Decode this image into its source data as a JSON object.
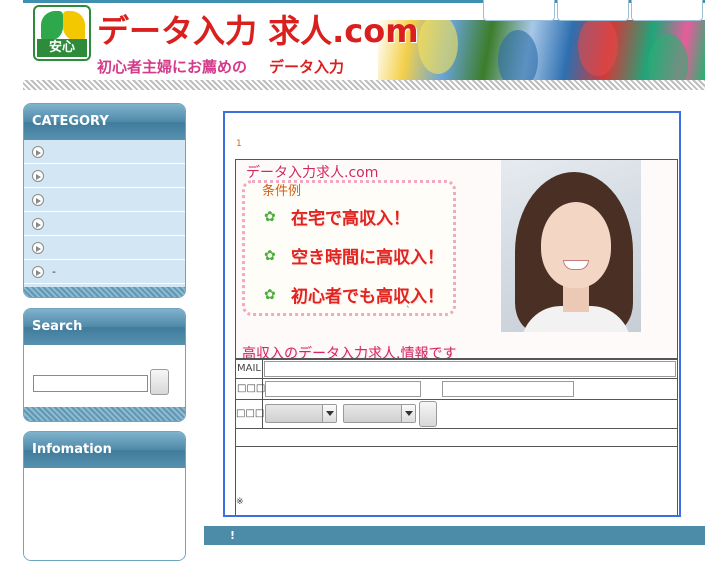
{
  "header": {
    "logo_badge_text": "安心",
    "site_title": "データ入力 求人.com",
    "tagline_main": "初心者主婦にお薦めの",
    "tagline_accent": "データ入力",
    "nav_tabs": [
      "",
      "",
      ""
    ]
  },
  "sidebar": {
    "category": {
      "title": "CATEGORY",
      "items": [
        "",
        "",
        "",
        "",
        "",
        "-"
      ]
    },
    "search": {
      "title": "Search",
      "input_value": "",
      "button_label": ""
    },
    "information": {
      "title": "Infomation"
    }
  },
  "main": {
    "marker": "1",
    "banner": {
      "title": "データ入力求人.com",
      "conditions_label": "条件例",
      "conditions": [
        "在宅で高収入！",
        "空き時間に高収入！",
        "初心者でも高収入！"
      ],
      "bottom_text": "高収入のデータ入力求人.情報です",
      "photo_dot": "`"
    },
    "form": {
      "mail_label": "MAIL",
      "name_label": "□□□",
      "area_label": "□□□□",
      "mail_value": "",
      "name_first_value": "",
      "name_last_value": "",
      "select_1_value": "",
      "select_2_value": "",
      "note": "※"
    }
  },
  "bottom_bar": {
    "text": "!"
  },
  "colors": {
    "accent_blue": "#3c6fe0",
    "sidebar_head": "#4f89a8",
    "category_item_bg": "#d3e6f4",
    "title_red": "#d9201f",
    "banner_pink": "#d02860"
  }
}
